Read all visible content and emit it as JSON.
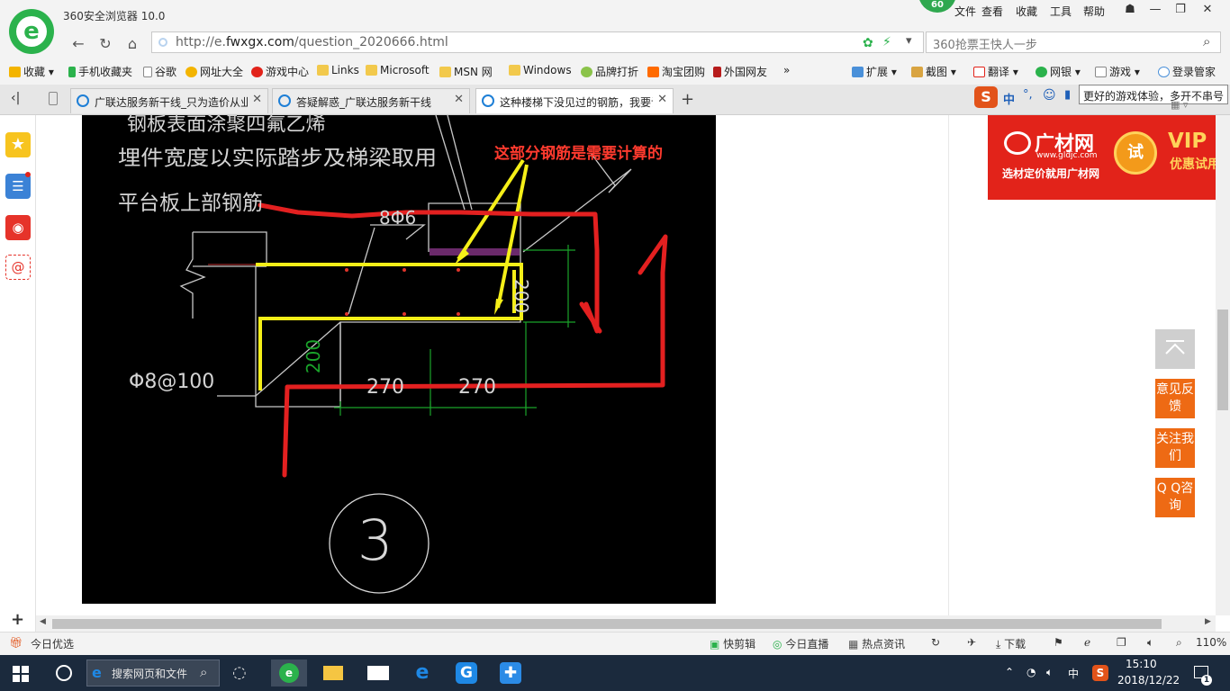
{
  "browser": {
    "app_title": "360安全浏览器 10.0",
    "badge_count": "60",
    "menu": [
      "文件",
      "查看",
      "收藏",
      "工具",
      "帮助"
    ],
    "url_prefix": "http://e.",
    "url_domain": "fwxgx.com",
    "url_path": "/question_2020666.html",
    "search_placeholder": "360抢票王快人一步",
    "bookmarks": [
      "收藏",
      "手机收藏夹",
      "谷歌",
      "网址大全",
      "游戏中心",
      "Links",
      "Microsoft",
      "MSN 网",
      "Windows",
      "品牌打折",
      "淘宝团购",
      "外国网友"
    ],
    "bookmark_more": "»",
    "toolbar_right": [
      "扩展",
      "截图",
      "翻译",
      "网银",
      "游戏",
      "登录管家"
    ],
    "tabs": [
      {
        "label": "广联达服务新干线_只为造价从业人员"
      },
      {
        "label": "答疑解惑_广联达服务新干线"
      },
      {
        "label": "这种楼梯下没见过的钢筋，我要计算"
      }
    ],
    "tooltip": "更好的游戏体验，多开不串号",
    "ime_text": "中"
  },
  "cad": {
    "annotation_red": "这部分钢筋是需要计算的",
    "text_top1": "钢板表面涂聚四氟乙烯",
    "text_top2": "埋件宽度以实际踏步及梯梁取用",
    "text_platform": "平台板上部钢筋",
    "text_phi6": "8Φ6",
    "text_phi8": "Φ8@100",
    "dim_200_right": "200",
    "dim_200_left": "200",
    "dim_270_a": "270",
    "dim_270_b": "270",
    "detail_no": "3"
  },
  "ad": {
    "brand": "广材网",
    "url": "www.gldjc.com",
    "slogan": "选材定价就用广材网",
    "try": "试",
    "vip": "VIP",
    "vip_sub": "优惠试用"
  },
  "side_buttons": {
    "feedback": "意见反馈",
    "follow": "关注我们",
    "qq": "Q Q咨询"
  },
  "statusbar": {
    "left": "今日优选",
    "items": [
      "快剪辑",
      "今日直播",
      "热点资讯",
      "下载"
    ],
    "zoom": "110%"
  },
  "taskbar": {
    "search_placeholder": "搜索网页和文件",
    "ime": "中",
    "time": "15:10",
    "date": "2018/12/22",
    "notif_count": "1"
  }
}
